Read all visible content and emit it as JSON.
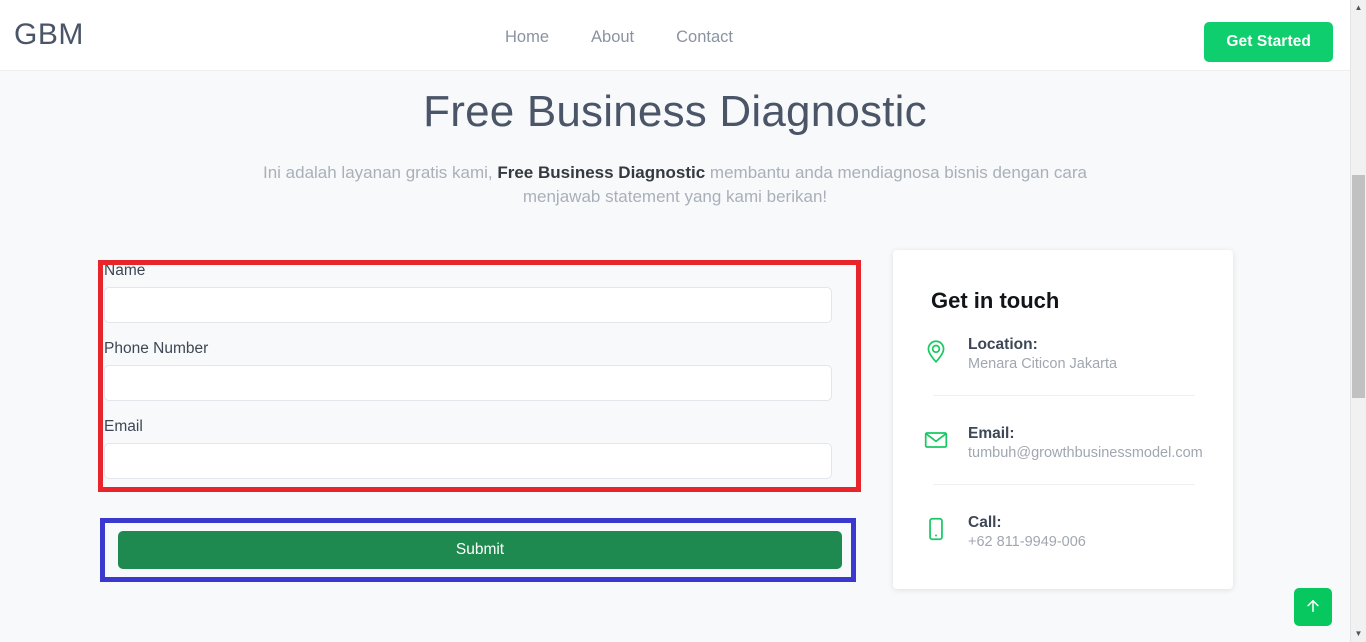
{
  "header": {
    "logo": "GBM",
    "nav": [
      {
        "label": "Home",
        "name": "nav-link-home"
      },
      {
        "label": "About",
        "name": "nav-link-about"
      },
      {
        "label": "Contact",
        "name": "nav-link-contact"
      }
    ],
    "cta_label": "Get Started",
    "cta_color": "#0ece6d"
  },
  "hero": {
    "title": "Free Business Diagnostic",
    "subtitle_before": "Ini adalah layanan gratis kami, ",
    "subtitle_bold": "Free Business Diagnostic",
    "subtitle_after": " membantu anda mendiagnosa bisnis dengan cara menjawab statement yang kami berikan!"
  },
  "form": {
    "fields": [
      {
        "label": "Name",
        "value": "",
        "placeholder": ""
      },
      {
        "label": "Phone Number",
        "value": "",
        "placeholder": ""
      },
      {
        "label": "Email",
        "value": "",
        "placeholder": ""
      }
    ],
    "submit_label": "Submit",
    "submit_color": "#1e8a50"
  },
  "annotations": {
    "red_box_color": "#e8252a",
    "blue_box_color": "#3b38cf"
  },
  "contact": {
    "title": "Get in touch",
    "items": [
      {
        "icon": "location-pin-icon",
        "title": "Location:",
        "value": "Menara Citicon Jakarta"
      },
      {
        "icon": "envelope-icon",
        "title": "Email:",
        "value": "tumbuh@growthbusinessmodel.com"
      },
      {
        "icon": "mobile-phone-icon",
        "title": "Call:",
        "value": "+62 811-9949-006"
      }
    ],
    "icon_color": "#18c964"
  },
  "scroll_top": {
    "icon": "arrow-up-icon",
    "color": "#07c75f"
  },
  "scrollbar": {
    "up_icon": "scroll-up-arrow-icon",
    "down_icon": "scroll-down-arrow-icon"
  }
}
